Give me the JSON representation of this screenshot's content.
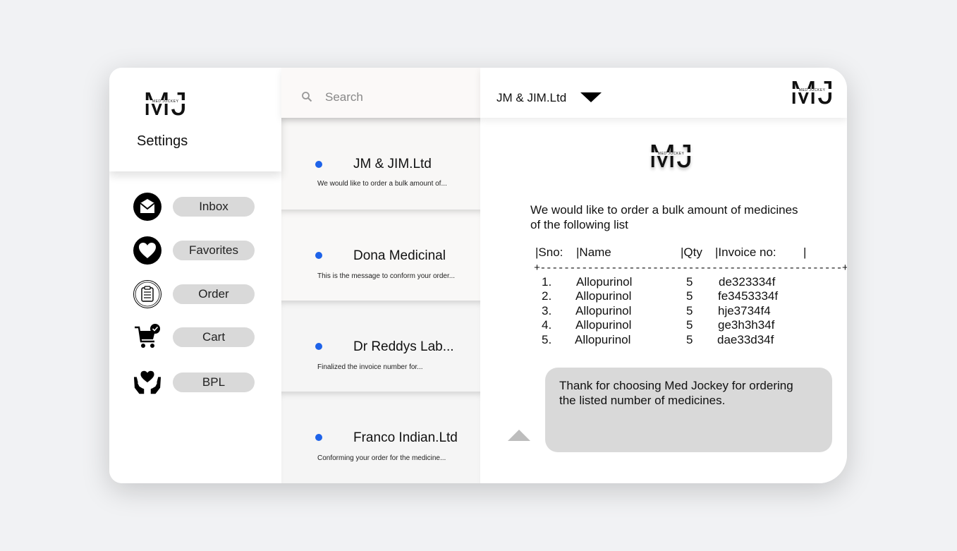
{
  "brand": {
    "logo": "MJ",
    "logo_sub": "MED JOCKEY"
  },
  "sidebar": {
    "title": "Settings",
    "items": [
      {
        "label": "Inbox",
        "icon": "mail-icon"
      },
      {
        "label": "Favorites",
        "icon": "heart-icon"
      },
      {
        "label": "Order",
        "icon": "clipboard-icon"
      },
      {
        "label": "Cart",
        "icon": "cart-icon"
      },
      {
        "label": "BPL",
        "icon": "hands-heart-icon"
      }
    ]
  },
  "search": {
    "placeholder": "Search"
  },
  "messages": [
    {
      "title": "JM & JIM.Ltd",
      "preview": "We would like to order a bulk amount of..."
    },
    {
      "title": "Dona Medicinal",
      "preview": "This is the message to conform your order..."
    },
    {
      "title": "Dr Reddys Lab...",
      "preview": "Finalized the invoice number for..."
    },
    {
      "title": "Franco Indian.Ltd",
      "preview": "Conforming your order for the medicine..."
    }
  ],
  "detail": {
    "company": "JM & JIM.Ltd",
    "body_line1": "We would like to order a bulk amount of medicines",
    "body_line2": "of the following list",
    "table": {
      "headers": [
        "|Sno:",
        "|Name",
        "|Qty",
        "|Invoice no:",
        "|"
      ],
      "rule": "+---------------------------------------------------+",
      "rows": [
        [
          "1.",
          "Allopurinol",
          "5",
          "de323334f"
        ],
        [
          "2.",
          "Allopurinol",
          "5",
          "fe3453334f"
        ],
        [
          "3.",
          "Allopurinol",
          "5",
          "hje3734f4"
        ],
        [
          "4.",
          "Allopurinol",
          "5",
          "ge3h3h34f"
        ],
        [
          "5.",
          "Allopurinol",
          "5",
          "dae33d34f"
        ]
      ]
    },
    "reply": "Thank for choosing Med Jockey for ordering\n the listed number of medicines."
  },
  "colors": {
    "unread_dot": "#1e63e9",
    "pill": "#d9d9d9",
    "reply_bg": "#d9d9d9"
  }
}
